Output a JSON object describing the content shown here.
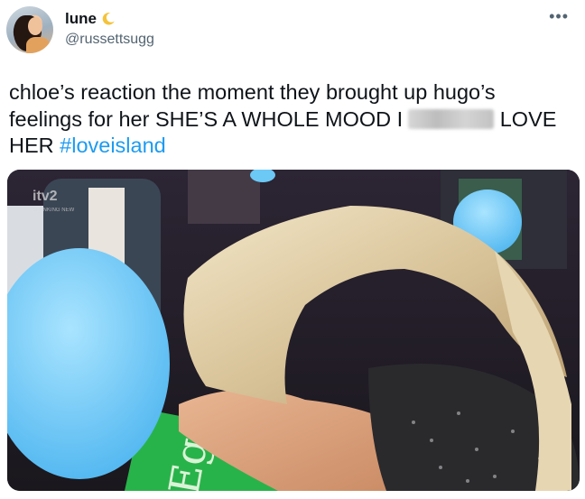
{
  "user": {
    "display_name": "lune",
    "handle": "@russettsugg"
  },
  "tweet": {
    "text_part1": "chloe’s reaction the moment they brought up hugo’s feelings for her SHE’S A WHOLE MOOD I",
    "text_part2": "LOVE HER",
    "hashtag": "#loveisland"
  },
  "media": {
    "watermark": "itv2",
    "watermark_sub": "SPANKING NEW"
  },
  "icons": {
    "moon": "crescent-moon-icon",
    "more": "more-options-icon"
  },
  "colors": {
    "accent": "#1d9bf0",
    "text": "#0f1419",
    "secondary": "#536471"
  }
}
